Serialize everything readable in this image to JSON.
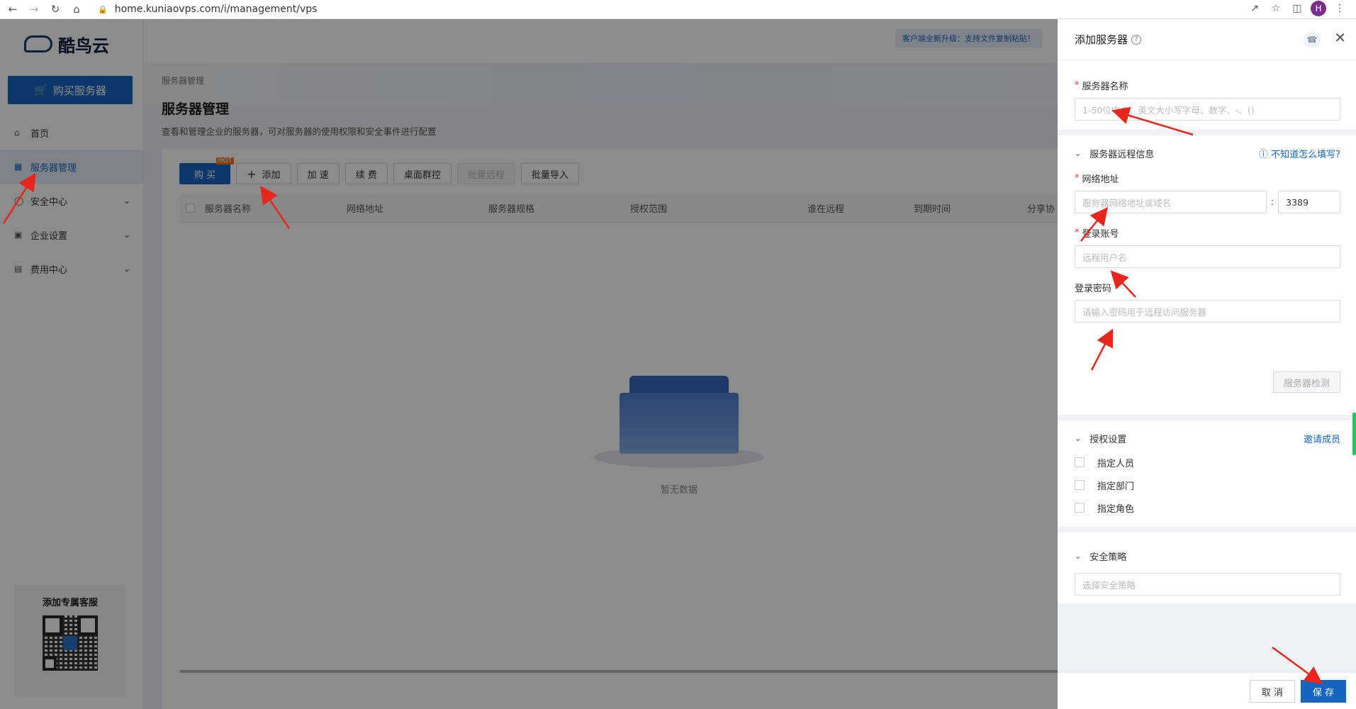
{
  "browser": {
    "url": "home.kuniaovps.com/i/management/vps",
    "avatar_letter": "H"
  },
  "sidebar": {
    "logo_text": "酷鸟云",
    "buy_button": "购买服务器",
    "items": [
      {
        "label": "首页",
        "icon": "home-icon"
      },
      {
        "label": "服务器管理",
        "icon": "grid-icon",
        "active": true
      },
      {
        "label": "安全中心",
        "icon": "shield-icon"
      },
      {
        "label": "企业设置",
        "icon": "building-icon"
      },
      {
        "label": "费用中心",
        "icon": "wallet-icon"
      }
    ],
    "support_title": "添加专属客服"
  },
  "main": {
    "notice": "客户端全新升级：支持文件复制粘贴！",
    "breadcrumb": "服务器管理",
    "title": "服务器管理",
    "description": "查看和管理企业的服务器，可对服务器的使用权限和安全事件进行配置",
    "toolbar": {
      "buy": "购 买",
      "hot": "HOT",
      "add": "添加",
      "accelerate": "加 速",
      "renew": "续 费",
      "desktop_control": "桌面群控",
      "batch_remote": "批量远程",
      "batch_import": "批量导入"
    },
    "columns": [
      "服务器名称",
      "网络地址",
      "服务器规格",
      "授权范围",
      "谁在远程",
      "到期时间",
      "分享协"
    ],
    "empty_text": "暂无数据"
  },
  "drawer": {
    "title": "添加服务器",
    "server_name_label": "服务器名称",
    "server_name_placeholder": "1-50位中文、英文大小写字母、数字、-、()",
    "remote_section": "服务器远程信息",
    "help_link": "不知道怎么填写?",
    "address_label": "网络地址",
    "address_placeholder": "服务器网络地址或域名",
    "port_value": "3389",
    "account_label": "登录账号",
    "account_placeholder": "远程用户名",
    "password_label": "登录密码",
    "password_placeholder": "请输入密码用于远程访问服务器",
    "detect_button": "服务器检测",
    "auth_section": "授权设置",
    "invite_link": "邀请成员",
    "auth_options": [
      "指定人员",
      "指定部门",
      "指定角色"
    ],
    "security_section": "安全策略",
    "security_placeholder": "选择安全策略",
    "cancel": "取 消",
    "save": "保 存"
  },
  "colors": {
    "primary": "#1565c0",
    "annotation": "#e8261c",
    "required": "#e53935"
  }
}
